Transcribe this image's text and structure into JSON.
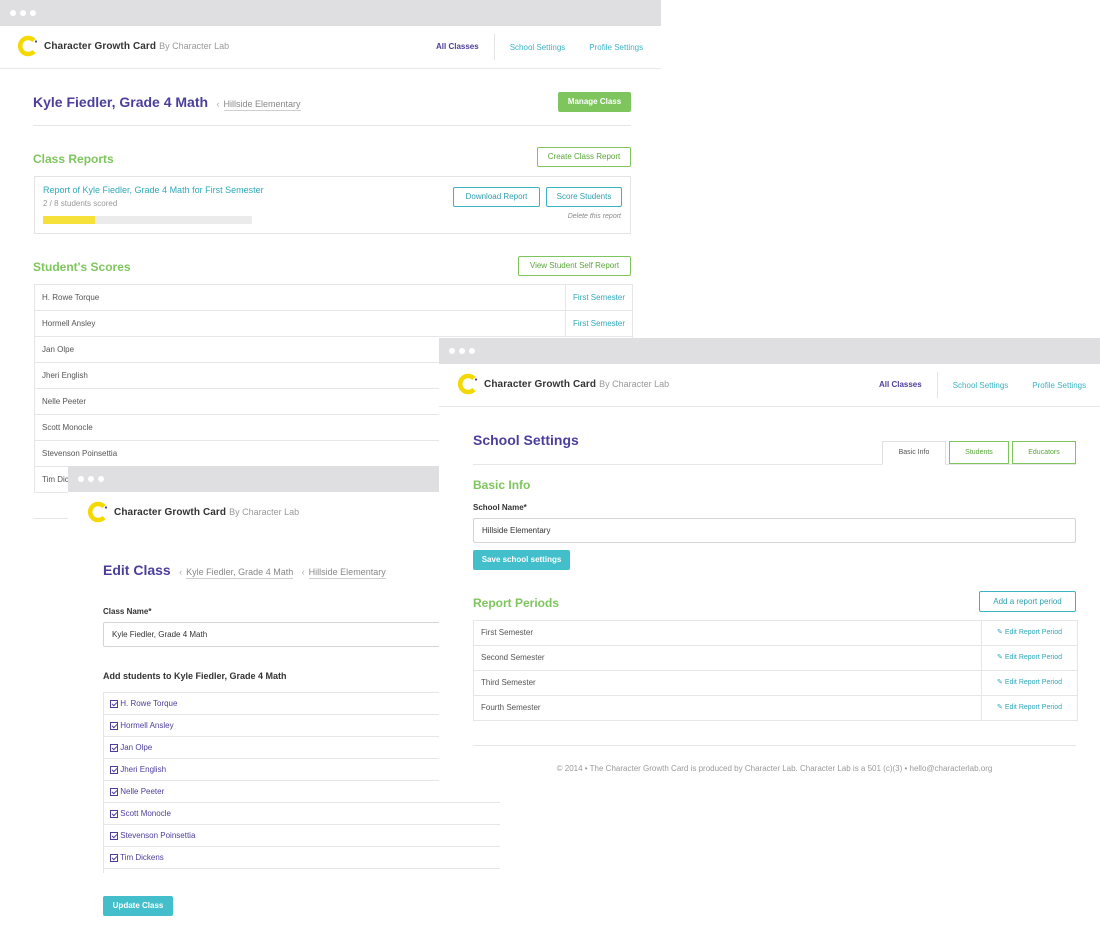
{
  "brand": {
    "name": "Character Growth Card",
    "by": "By Character Lab"
  },
  "nav": {
    "all_classes": "All Classes",
    "school_settings": "School Settings",
    "profile_settings": "Profile Settings"
  },
  "colors": {
    "purple": "#4c3f9b",
    "green": "#7fc55e",
    "teal": "#3bb3c3",
    "yellow": "#f5d800",
    "chrome": "#dfdfe2"
  },
  "class_page": {
    "title": "Kyle Fiedler, Grade 4 Math",
    "breadcrumb": "Hillside Elementary",
    "manage_button": "Manage Class",
    "reports_heading": "Class Reports",
    "create_report_button": "Create Class Report",
    "report": {
      "title": "Report of Kyle Fiedler, Grade 4 Math for First Semester",
      "progress_text": "2 / 8 students scored",
      "progress_fraction": 0.25,
      "download_button": "Download Report",
      "score_button": "Score Students",
      "delete_link": "Delete this report"
    },
    "scores_heading": "Student's Scores",
    "self_report_button": "View Student Self Report",
    "students": [
      {
        "name": "H. Rowe Torque",
        "period": "First Semester"
      },
      {
        "name": "Hormell Ansley",
        "period": "First Semester"
      },
      {
        "name": "Jan Olpe",
        "period": ""
      },
      {
        "name": "Jheri English",
        "period": ""
      },
      {
        "name": "Nelle Peeter",
        "period": ""
      },
      {
        "name": "Scott Monocle",
        "period": ""
      },
      {
        "name": "Stevenson Poinsettia",
        "period": ""
      },
      {
        "name": "Tim Dickens",
        "period": ""
      }
    ]
  },
  "edit_page": {
    "title": "Edit Class",
    "breadcrumb": [
      "Kyle Fiedler, Grade 4 Math",
      "Hillside Elementary"
    ],
    "class_name_label": "Class Name*",
    "class_name_value": "Kyle Fiedler, Grade 4 Math",
    "add_students_label": "Add students to Kyle Fiedler, Grade 4 Math",
    "students": [
      "H. Rowe Torque",
      "Hormell Ansley",
      "Jan Olpe",
      "Jheri English",
      "Nelle Peeter",
      "Scott Monocle",
      "Stevenson Poinsettia",
      "Tim Dickens"
    ],
    "update_button": "Update Class"
  },
  "school_page": {
    "title": "School Settings",
    "tabs": [
      "Basic Info",
      "Students",
      "Educators"
    ],
    "basic_info_heading": "Basic Info",
    "school_name_label": "School Name*",
    "school_name_value": "Hillside Elementary",
    "save_button": "Save school settings",
    "report_periods_heading": "Report Periods",
    "add_period_button": "Add a report period",
    "periods": [
      "First Semester",
      "Second Semester",
      "Third Semester",
      "Fourth Semester"
    ],
    "edit_period_label": "Edit Report Period",
    "footer": "© 2014 • The Character Growth Card is produced by Character Lab. Character Lab is a 501 (c)(3) • hello@characterlab.org"
  }
}
